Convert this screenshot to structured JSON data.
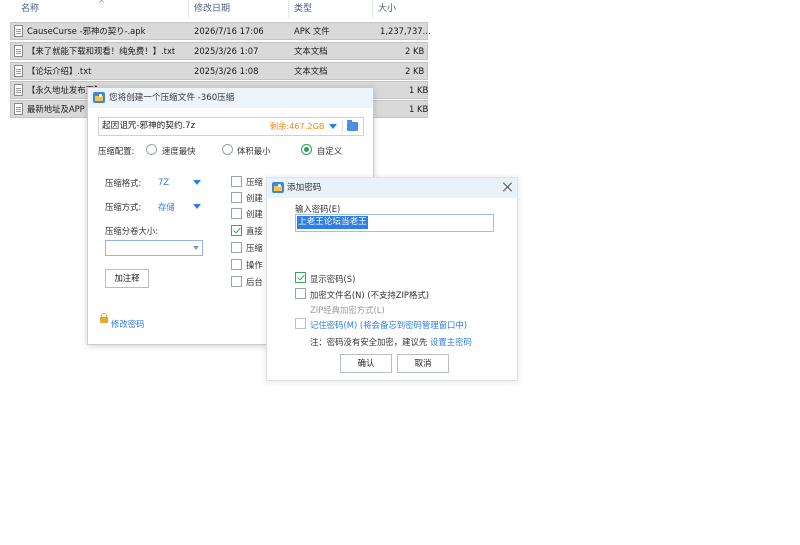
{
  "explorer": {
    "columns": {
      "name": "名称",
      "modified": "修改日期",
      "type": "类型",
      "size": "大小"
    },
    "sort_arrow": "^",
    "files": [
      {
        "name": "CauseCurse -邪神の契り-.apk",
        "modified": "2026/7/16 17:06",
        "type": "APK 文件",
        "size": "1,237,737..."
      },
      {
        "name": "【来了就能下载和观看！纯免费！】.txt",
        "modified": "2025/3/26 1:07",
        "type": "文本文档",
        "size": "2 KB"
      },
      {
        "name": "【论坛介绍】.txt",
        "modified": "2025/3/26 1:08",
        "type": "文本文档",
        "size": "2 KB"
      },
      {
        "name": "【永久地址发布页】",
        "modified": "",
        "type": "",
        "size": "1 KB"
      },
      {
        "name": "最新地址及APP",
        "modified": "",
        "type": "",
        "size": "1 KB"
      }
    ]
  },
  "compress_dialog": {
    "title": "您将创建一个压缩文件 -360压缩",
    "path": "起因诅咒-邪神的契约.7z",
    "free_space": "剩余:467.2GB",
    "config_label": "压缩配置:",
    "options": {
      "fastest": "速度最快",
      "smallest": "体积最小",
      "custom": "自定义"
    },
    "format_label": "压缩格式:",
    "format_value": "7Z",
    "method_label": "压缩方式:",
    "method_value": "存储",
    "volume_label": "压缩分卷大小:",
    "comment_button": "加注释",
    "right_options": [
      "压缩",
      "创建",
      "创建",
      "直接",
      "压缩",
      "操作",
      "后台"
    ],
    "right_checked": [
      false,
      false,
      false,
      true,
      false,
      false,
      false
    ],
    "modify_password": "修改密码"
  },
  "password_dialog": {
    "title": "添加密码",
    "input_label": "输入密码(E)",
    "password_value": "上老王论坛当老王",
    "show_password": "显示密码(S)",
    "encrypt_names": "加密文件名(N) (不支持ZIP格式)",
    "zip_classic": "ZIP经典加密方式(L)",
    "remember_password": "记住密码(M) (将会备忘到密码管理窗口中)",
    "note_prefix": "注：密码没有安全加密，建议先",
    "note_link": "设置主密码",
    "confirm": "确认",
    "cancel": "取消"
  },
  "colors": {
    "accent": "#2d7ee6",
    "free_space": "#f08a1a",
    "selection": "#2f7fe0",
    "checked": "#3aa55f"
  }
}
